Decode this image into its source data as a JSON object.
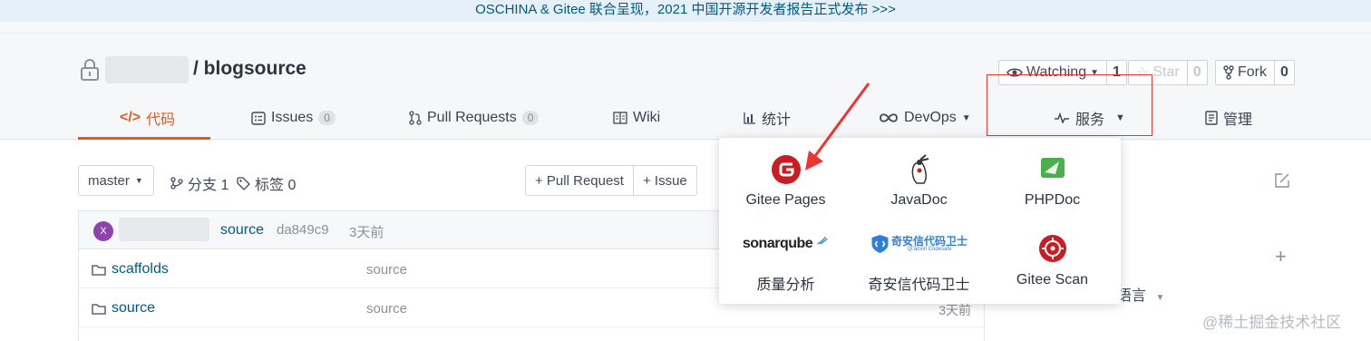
{
  "banner": {
    "text": "OSCHINA & Gitee 联合呈现，2021 中国开源开发者报告正式发布 >>>"
  },
  "repo": {
    "name": "/ blogsource"
  },
  "actions": {
    "watching": {
      "label": "Watching",
      "count": "1"
    },
    "star": {
      "label": "Star",
      "count": "0"
    },
    "fork": {
      "label": "Fork",
      "count": "0"
    }
  },
  "tabs": [
    {
      "label": "代码"
    },
    {
      "label": "Issues",
      "badge": "0"
    },
    {
      "label": "Pull Requests",
      "badge": "0"
    },
    {
      "label": "Wiki"
    },
    {
      "label": "统计"
    },
    {
      "label": "DevOps"
    },
    {
      "label": "服务"
    },
    {
      "label": "管理"
    }
  ],
  "toolbar": {
    "branch": "master",
    "branches": "分支 1",
    "tags": "标签 0",
    "pull_request": "+ Pull Request",
    "issue": "+ Issue"
  },
  "commit": {
    "avatar": "X",
    "message": "source",
    "sha": "da849c9",
    "time": "3天前"
  },
  "files": [
    {
      "name": "scaffolds",
      "message": "source",
      "time": ""
    },
    {
      "name": "source",
      "message": "source",
      "time": "3天前"
    }
  ],
  "sidebar": {
    "lang_partial": "语言"
  },
  "services_menu": [
    {
      "label": "Gitee Pages",
      "icon": "gitee-pages-icon"
    },
    {
      "label": "JavaDoc",
      "icon": "javadoc-icon"
    },
    {
      "label": "PHPDoc",
      "icon": "phpdoc-icon"
    },
    {
      "label": "质量分析",
      "icon": "sonarqube-icon",
      "brand": "sonarqube"
    },
    {
      "label": "奇安信代码卫士",
      "icon": "qianxin-icon",
      "brand": "奇安信代码卫士",
      "brand_sub": "Qi'anxin Codesafe"
    },
    {
      "label": "Gitee Scan",
      "icon": "gitee-scan-icon"
    }
  ],
  "watermark": "@稀土掘金技术社区",
  "colors": {
    "accent": "#e5571b",
    "link": "#005980",
    "annotation": "#e33333"
  }
}
